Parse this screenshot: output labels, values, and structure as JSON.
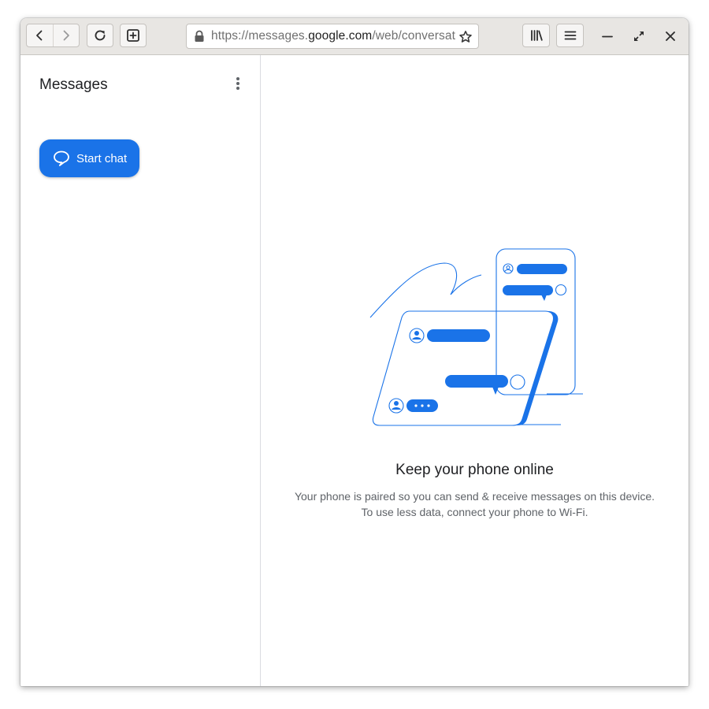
{
  "browser": {
    "url_prefix": "https://messages.",
    "url_domain": "google.com",
    "url_path": "/web/conversat",
    "back_icon": "chevron-left-icon",
    "forward_icon": "chevron-right-icon",
    "reload_icon": "reload-icon",
    "new_tab_icon": "new-tab-icon",
    "lock_icon": "lock-icon",
    "bookmark_icon": "star-icon",
    "library_icon": "library-icon",
    "menu_icon": "hamburger-menu-icon",
    "minimize_icon": "minimize-icon",
    "maximize_icon": "maximize-icon",
    "close_icon": "close-icon"
  },
  "sidebar": {
    "title": "Messages",
    "more_icon": "more-vertical-icon",
    "start_chat_label": "Start chat",
    "start_chat_icon": "chat-bubble-icon"
  },
  "main": {
    "headline": "Keep your phone online",
    "description_line1": "Your phone is paired so you can send & receive messages on this device.",
    "description_line2": "To use less data, connect your phone to Wi-Fi."
  },
  "colors": {
    "accent": "#1a73e8",
    "toolbar_bg": "#e8e6e3",
    "text_primary": "#202124",
    "text_secondary": "#5f6368"
  }
}
